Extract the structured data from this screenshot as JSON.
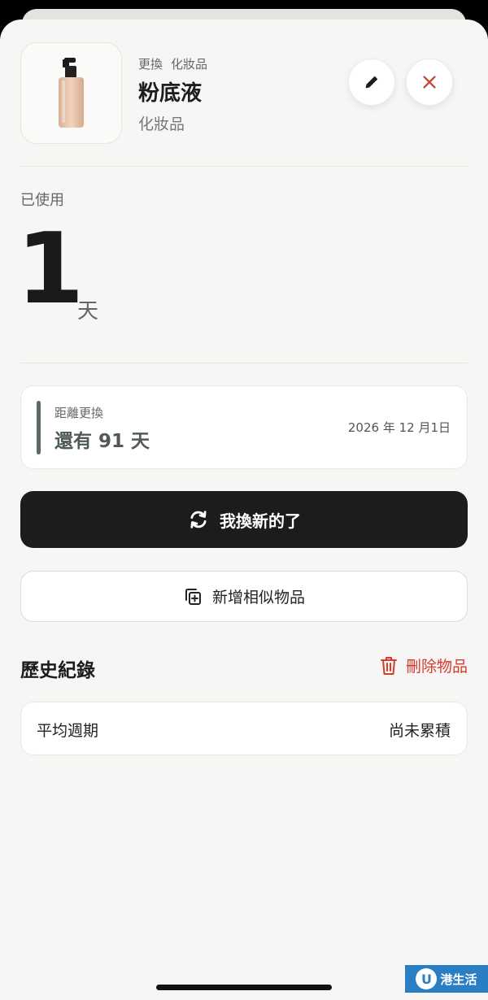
{
  "item": {
    "tag_action": "更換",
    "tag_category": "化妝品",
    "name": "粉底液",
    "category": "化妝品"
  },
  "usage": {
    "label": "已使用",
    "count": "1",
    "unit": "天"
  },
  "replacement": {
    "label": "距離更換",
    "remaining": "還有 91 天",
    "date": "2026 年 12 月1日"
  },
  "actions": {
    "replaced_label": "我換新的了",
    "add_similar_label": "新增相似物品"
  },
  "history": {
    "title": "歷史紀錄",
    "delete_label": "刪除物品",
    "avg_cycle_label": "平均週期",
    "avg_cycle_value": "尚未累積"
  },
  "watermark": {
    "logo": "U",
    "text": "港生活"
  },
  "icons": {
    "edit": "pencil-icon",
    "close": "close-icon",
    "refresh": "refresh-icon",
    "add_copy": "add-copy-icon",
    "trash": "trash-icon"
  },
  "colors": {
    "accent_dark": "#1c1c1c",
    "danger": "#d83a2e",
    "progress_bar": "#5c6a67"
  }
}
